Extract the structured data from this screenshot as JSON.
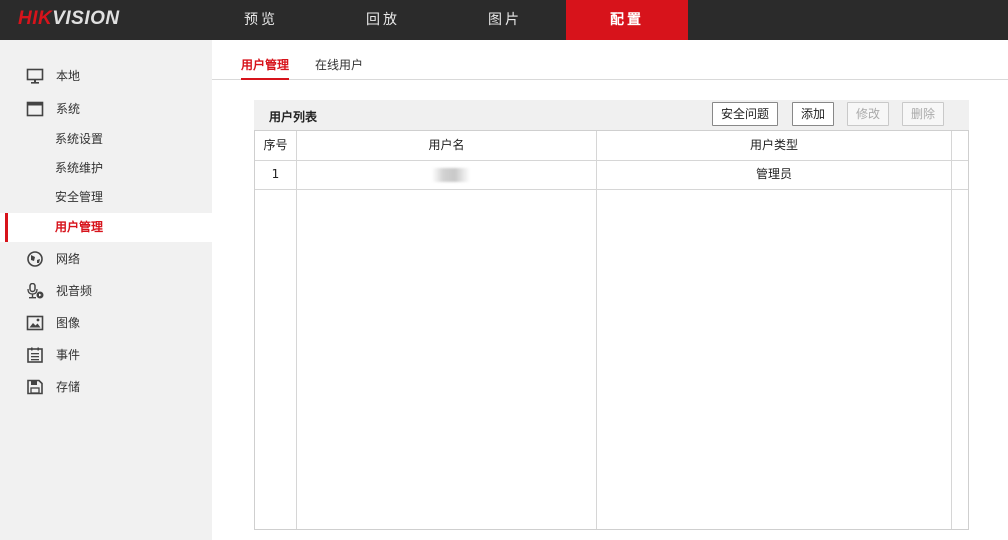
{
  "brand": {
    "logo_red": "HIK",
    "logo_rest": "VISION"
  },
  "nav": {
    "items": [
      "预览",
      "回放",
      "图片",
      "配置"
    ],
    "active": "配置"
  },
  "sidebar": {
    "local": "本地",
    "system": "系统",
    "system_sub": [
      "系统设置",
      "系统维护",
      "安全管理",
      "用户管理"
    ],
    "network": "网络",
    "video_audio": "视音频",
    "image": "图像",
    "event": "事件",
    "storage": "存储"
  },
  "tabs": [
    "用户管理",
    "在线用户"
  ],
  "panel": {
    "title": "用户列表",
    "buttons": {
      "security": "安全问题",
      "add": "添加",
      "modify": "修改",
      "delete": "删除"
    }
  },
  "table": {
    "headers": [
      "序号",
      "用户名",
      "用户类型"
    ],
    "rows": [
      {
        "index": "1",
        "username": "",
        "type": "管理员"
      }
    ]
  },
  "colors": {
    "accent": "#d7131b",
    "topbar": "#2b2b2b",
    "sidebar": "#f1f1f1"
  }
}
